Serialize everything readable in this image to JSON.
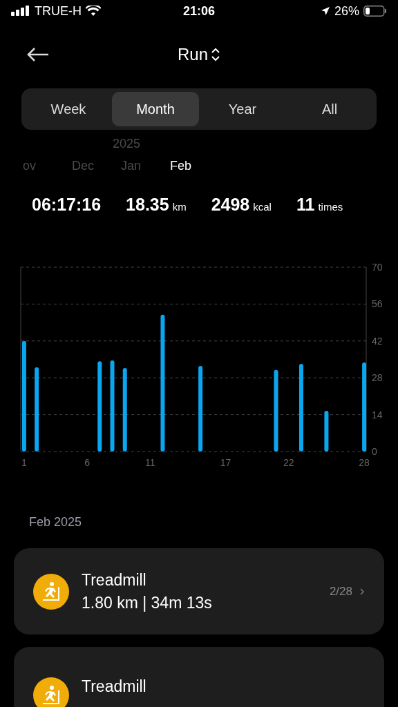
{
  "status_bar": {
    "carrier": "TRUE-H",
    "time": "21:06",
    "battery": "26%"
  },
  "header": {
    "title": "Run"
  },
  "tabs": [
    {
      "label": "Week",
      "selected": false
    },
    {
      "label": "Month",
      "selected": true
    },
    {
      "label": "Year",
      "selected": false
    },
    {
      "label": "All",
      "selected": false
    }
  ],
  "months": {
    "year": "2025",
    "items": [
      {
        "label": "ov",
        "selected": false
      },
      {
        "label": "Dec",
        "selected": false
      },
      {
        "label": "Jan",
        "selected": false
      },
      {
        "label": "Feb",
        "selected": true
      }
    ]
  },
  "stats": [
    {
      "value": "06:17:16"
    },
    {
      "value": "18.35",
      "unit": "km"
    },
    {
      "value": "2498",
      "unit": "kcal"
    },
    {
      "value": "11",
      "unit": "times"
    }
  ],
  "chart": {
    "chart_data": {
      "type": "bar",
      "x": [
        1,
        2,
        7,
        8,
        9,
        12,
        15,
        21,
        23,
        25,
        28
      ],
      "values": [
        42,
        32,
        34.3,
        34.6,
        31.7,
        52,
        32.5,
        31,
        33.3,
        15.5,
        33.8
      ],
      "xlim": [
        0.73,
        28.16
      ],
      "ylim": [
        0,
        70
      ],
      "yticks": [
        0,
        14,
        28,
        42,
        56,
        70
      ],
      "xticks": [
        1,
        6,
        11,
        17,
        22,
        28
      ],
      "grid": true
    }
  },
  "list_heading": "Feb 2025",
  "activities": [
    {
      "name": "Treadmill",
      "summary": "1.80 km | 34m 13s",
      "date": "2/28"
    },
    {
      "name": "Treadmill"
    }
  ]
}
